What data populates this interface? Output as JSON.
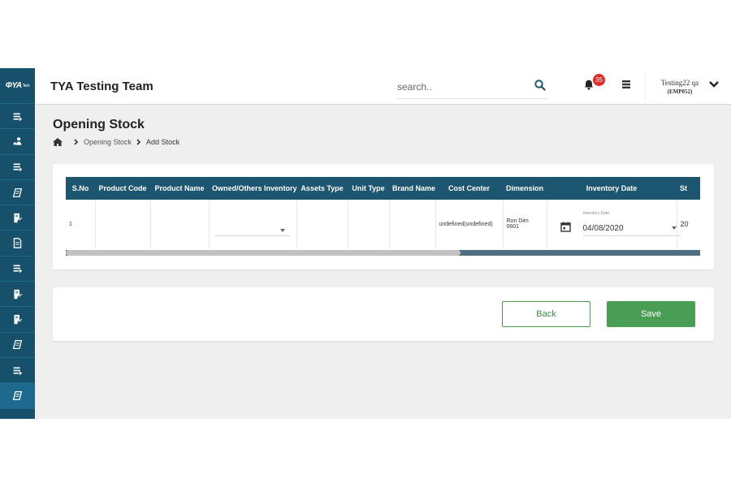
{
  "brand": {
    "logo_text": "ΦYA",
    "logo_sub": "Tech"
  },
  "header": {
    "app_title": "TYA Testing Team",
    "search_placeholder": "search..",
    "notification_count": "35",
    "user_name": "Testing22 qa",
    "user_code": "(EMP052)"
  },
  "sidebar": {
    "items": [
      {
        "icon": "stack-icon"
      },
      {
        "icon": "user-pin-icon"
      },
      {
        "icon": "stack-icon"
      },
      {
        "icon": "notes-icon"
      },
      {
        "icon": "document-edit-icon"
      },
      {
        "icon": "document-icon"
      },
      {
        "icon": "stack-icon"
      },
      {
        "icon": "document-edit-icon"
      },
      {
        "icon": "document-edit-icon"
      },
      {
        "icon": "notes-icon"
      },
      {
        "icon": "stack-icon"
      },
      {
        "icon": "notes-icon",
        "active": true
      }
    ]
  },
  "page": {
    "title": "Opening Stock",
    "breadcrumb": [
      "Opening Stock",
      "Add Stock"
    ]
  },
  "table": {
    "columns": [
      "S.No",
      "Product Code",
      "Product Name",
      "Owned/Others Inventory",
      "Assets Type",
      "Unit Type",
      "Brand Name",
      "Cost Center",
      "Dimension",
      "Inventory Date",
      "St"
    ],
    "row": {
      "sno": "1",
      "product_code": "",
      "product_name": "",
      "owned_others": "",
      "assets_type": "",
      "unit_type": "",
      "brand_name": "",
      "cost_center": "undefined(undefined)",
      "dimension_line1": "Ron Dim",
      "dimension_line2": "0601",
      "inventory_date_label": "Inventory Date",
      "inventory_date": "04/08/2020",
      "cut_value": "20"
    },
    "scroll_position_fraction": 0.62
  },
  "actions": {
    "back": "Back",
    "save": "Save"
  },
  "colors": {
    "sidebar": "#17506a",
    "table_header": "#1d5671",
    "primary_green": "#4a9d55",
    "badge_red": "#e52a2a"
  }
}
